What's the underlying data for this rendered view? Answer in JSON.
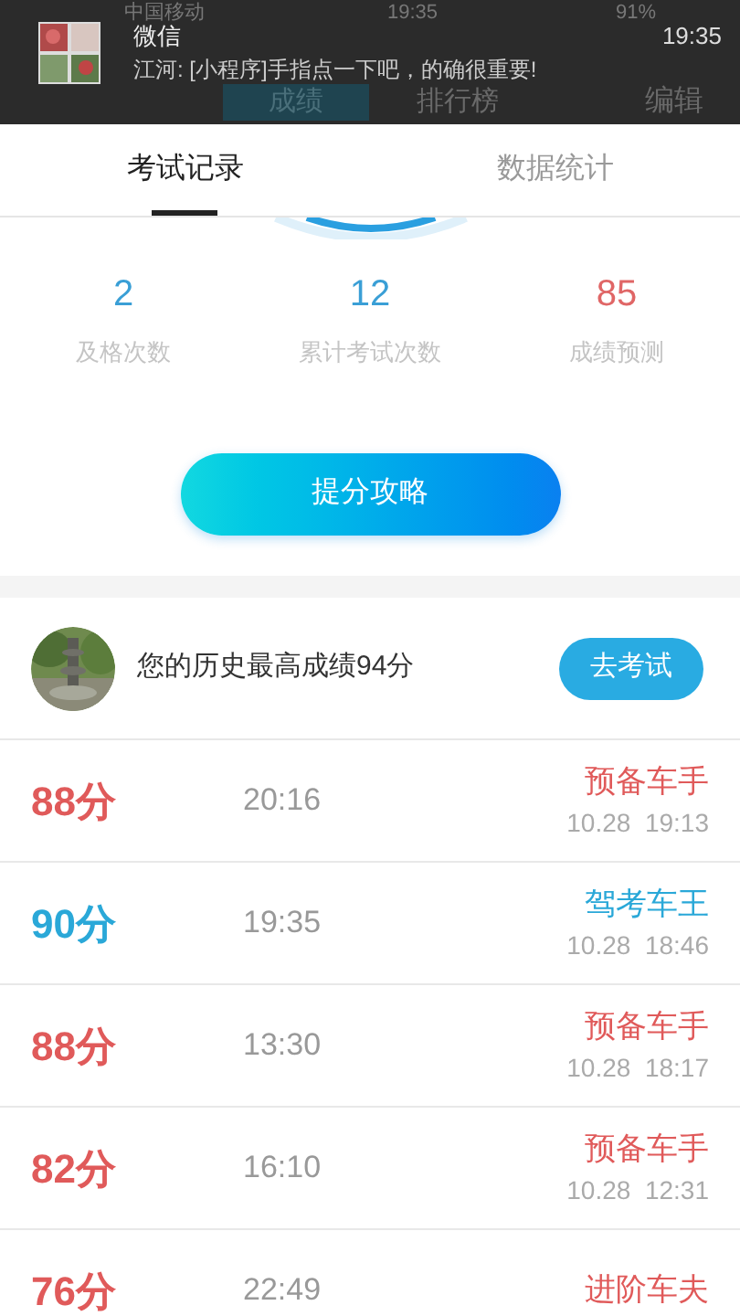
{
  "status_bar": {
    "carrier": "中国移动",
    "time": "19:35",
    "battery": "91%"
  },
  "notification": {
    "app": "微信",
    "message": "江河: [小程序]手指点一下吧，的确很重要!",
    "time": "19:35"
  },
  "nav": {
    "tabs": [
      {
        "label": "成绩",
        "selected": true
      },
      {
        "label": "排行榜",
        "selected": false
      }
    ],
    "edit": "编辑"
  },
  "tabs": [
    {
      "label": "考试记录",
      "selected": true
    },
    {
      "label": "数据统计",
      "selected": false
    }
  ],
  "stats": [
    {
      "value": "2",
      "label": "及格次数",
      "color": "#3a9fd6"
    },
    {
      "value": "12",
      "label": "累计考试次数",
      "color": "#3a9fd6"
    },
    {
      "value": "85",
      "label": "成绩预测",
      "color": "#e06666"
    }
  ],
  "boost_button": "提分攻略",
  "best": {
    "text": "您的历史最高成绩94分",
    "button": "去考试"
  },
  "records": [
    {
      "score": "88分",
      "duration": "20:16",
      "rank": "预备车手",
      "date": "10.28  19:13",
      "color": "#e05a5a"
    },
    {
      "score": "90分",
      "duration": "19:35",
      "rank": "驾考车王",
      "date": "10.28  18:46",
      "color": "#2aa8d8"
    },
    {
      "score": "88分",
      "duration": "13:30",
      "rank": "预备车手",
      "date": "10.28  18:17",
      "color": "#e05a5a"
    },
    {
      "score": "82分",
      "duration": "16:10",
      "rank": "预备车手",
      "date": "10.28  12:31",
      "color": "#e05a5a"
    },
    {
      "score": "76分",
      "duration": "22:49",
      "rank": "进阶车夫",
      "color": "#e05a5a"
    }
  ]
}
